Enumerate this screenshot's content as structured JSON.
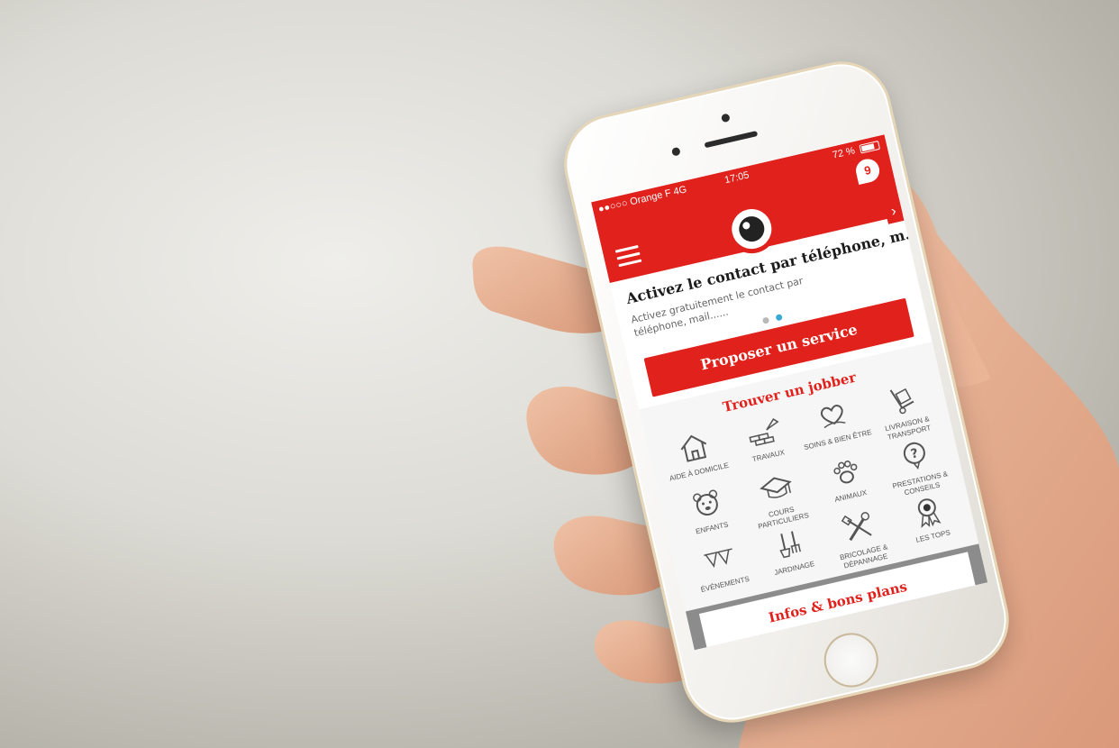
{
  "status_bar": {
    "carrier": "●●○○○ Orange F  4G",
    "time": "17:05",
    "battery": "72 %"
  },
  "header": {
    "chat_badge": "9"
  },
  "banner": {
    "title": "Activez le contact par téléphone, m...",
    "text": "Activez gratuitement le contact par téléphone, mail......",
    "arrow": "›",
    "pages": 2,
    "active_page": 2
  },
  "propose_button": "Proposer un service",
  "find_section": {
    "title": "Trouver un jobber",
    "categories": [
      {
        "label": "Aide à domicile",
        "icon": "house-icon"
      },
      {
        "label": "Travaux",
        "icon": "bricks-trowel-icon"
      },
      {
        "label": "Soins & bien être",
        "icon": "flower-heart-icon"
      },
      {
        "label": "Livraison & transport",
        "icon": "hand-truck-icon"
      },
      {
        "label": "Enfants",
        "icon": "teddy-bear-icon"
      },
      {
        "label": "Cours particuliers",
        "icon": "graduation-cap-icon"
      },
      {
        "label": "Animaux",
        "icon": "paw-icon"
      },
      {
        "label": "Prestations & conseils",
        "icon": "question-bubble-icon"
      },
      {
        "label": "Événements",
        "icon": "bunting-icon"
      },
      {
        "label": "Jardinage",
        "icon": "garden-tools-icon"
      },
      {
        "label": "Bricolage & dépannage",
        "icon": "wrench-screwdriver-icon"
      },
      {
        "label": "Les tops",
        "icon": "award-ribbon-icon"
      }
    ]
  },
  "infos_button": "Infos & bons plans",
  "colors": {
    "brand_red": "#e0211c",
    "pager_active": "#39a9d6"
  }
}
